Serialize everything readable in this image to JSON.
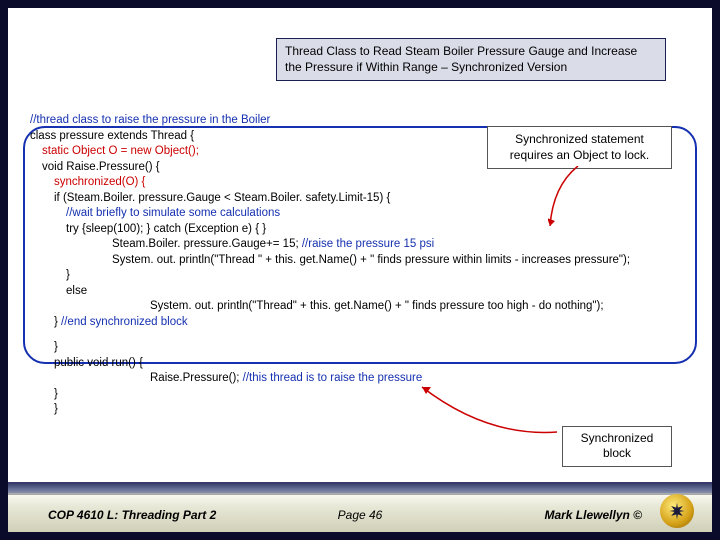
{
  "title": "Thread Class to Read Steam Boiler Pressure Gauge and Increase the Pressure if Within Range – Synchronized Version",
  "annot1": "Synchronized statement requires an Object to lock.",
  "annot2": "Synchronized block",
  "code": {
    "l1": "//thread class to raise the pressure in the Boiler",
    "l2": "class pressure extends Thread {",
    "l3": "static Object O = new Object();",
    "l4": "void Raise.Pressure() {",
    "l5": "synchronized(O) {",
    "l6": "if (Steam.Boiler. pressure.Gauge < Steam.Boiler. safety.Limit-15) {",
    "l7a": "//wait briefly to simulate some calculations",
    "l7b": "try {sleep(100); } catch (Exception e) { }",
    "l8a": "Steam.Boiler. pressure.Gauge+= 15;",
    "l8b": " //raise the pressure 15 psi",
    "l9": "System. out. println(\"Thread \" + this. get.Name() + \"  finds pressure within limits - increases pressure\");",
    "l10": "}",
    "l11": "else",
    "l12": "System. out. println(\"Thread\" + this. get.Name() + \"  finds pressure too high - do nothing\");",
    "l13a": "}",
    "l13b": " //end synchronized block",
    "l14": "}",
    "l15": "public void run() {",
    "l16a": "Raise.Pressure();",
    "l16b": "   //this thread is to raise the pressure",
    "l17": "}",
    "l18": "}"
  },
  "footer": {
    "left": "COP 4610 L: Threading Part 2",
    "mid": "Page 46",
    "right": "Mark Llewellyn ©"
  }
}
